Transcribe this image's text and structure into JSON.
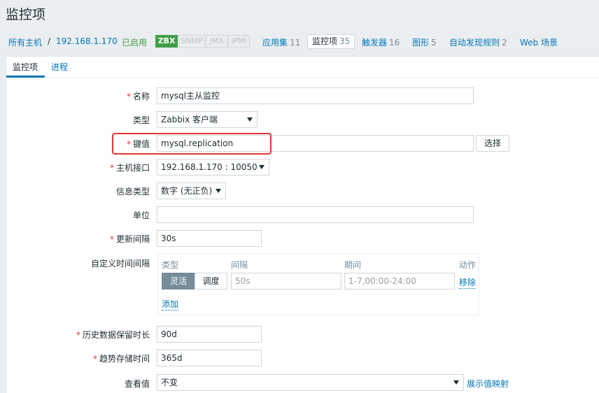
{
  "page": {
    "title": "监控项"
  },
  "breadcrumbs": {
    "all_hosts": "所有主机",
    "separator": "/",
    "host": "192.168.1.170",
    "status": "已启用",
    "availability": [
      "ZBX",
      "SNMP",
      "JMX",
      "IPMI"
    ],
    "applications": {
      "label": "应用集",
      "count": "11"
    },
    "items": {
      "label": "监控项",
      "count": "35"
    },
    "triggers": {
      "label": "触发器",
      "count": "16"
    },
    "graphs": {
      "label": "图形",
      "count": "5"
    },
    "discovery": {
      "label": "自动发现规则",
      "count": "2"
    },
    "web": {
      "label": "Web 场景"
    }
  },
  "tabs": {
    "item": "监控项",
    "process": "进程"
  },
  "form": {
    "name": {
      "label": "名称",
      "value": "mysql主从监控"
    },
    "type": {
      "label": "类型",
      "value": "Zabbix 客户端"
    },
    "key": {
      "label": "键值",
      "value": "mysql.replication",
      "select_button": "选择"
    },
    "host_interface": {
      "label": "主机接口",
      "value": "192.168.1.170 : 10050"
    },
    "info_type": {
      "label": "信息类型",
      "value": "数字 (无正负)"
    },
    "units": {
      "label": "单位",
      "value": ""
    },
    "update_interval": {
      "label": "更新间隔",
      "value": "30s"
    },
    "custom_intervals": {
      "label": "自定义时间间隔",
      "headers": {
        "type": "类型",
        "interval": "间隔",
        "period": "期间",
        "action": "动作"
      },
      "row": {
        "flexible": "灵活",
        "scheduling": "调度",
        "interval_placeholder": "50s",
        "period_placeholder": "1-7,00:00-24:00",
        "remove": "移除"
      },
      "add": "添加"
    },
    "history": {
      "label": "历史数据保留时长",
      "value": "90d"
    },
    "trends": {
      "label": "趋势存储时间",
      "value": "365d"
    },
    "show_value": {
      "label": "查看值",
      "value": "不变",
      "mapping_link": "展示值映射"
    }
  }
}
